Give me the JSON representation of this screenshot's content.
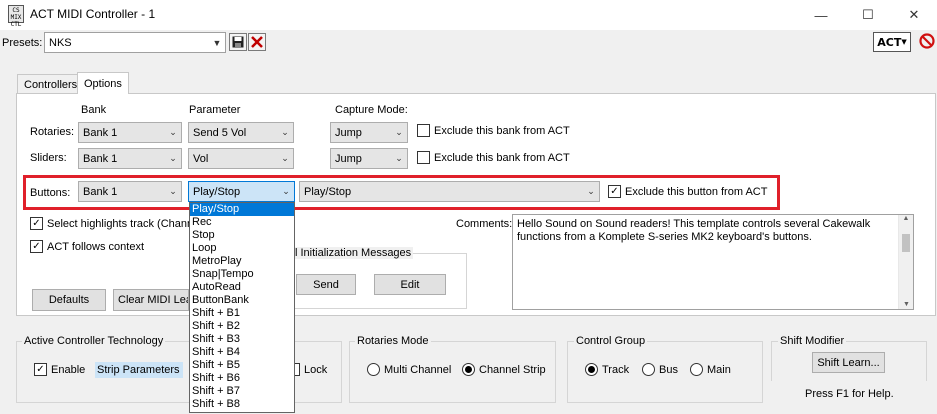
{
  "window": {
    "title": "ACT MIDI Controller - 1",
    "icon_text": "CS\nMIX\nCTL",
    "minimize": "—",
    "maximize": "☐",
    "close": "✕"
  },
  "presets": {
    "label": "Presets:",
    "value": "NKS",
    "act_logo": "ACT"
  },
  "tabs": [
    {
      "label": "Controllers"
    },
    {
      "label": "Options"
    }
  ],
  "columns": {
    "bank": "Bank",
    "parameter": "Parameter",
    "capture_mode": "Capture Mode:"
  },
  "rotaries": {
    "label": "Rotaries:",
    "bank": "Bank 1",
    "parameter": "Send 5 Vol",
    "capture": "Jump",
    "exclude_label": "Exclude this bank from ACT",
    "exclude_checked": false
  },
  "sliders": {
    "label": "Sliders:",
    "bank": "Bank 1",
    "parameter": "Vol",
    "capture": "Jump",
    "exclude_label": "Exclude this bank from ACT",
    "exclude_checked": false
  },
  "buttons": {
    "label": "Buttons:",
    "bank": "Bank 1",
    "parameter": "Play/Stop",
    "action": "Play/Stop",
    "exclude_label": "Exclude this button from ACT",
    "exclude_checked": true
  },
  "options": {
    "select_highlights": {
      "label": "Select highlights track (Channe",
      "checked": true
    },
    "act_follows": {
      "label": "ACT follows context",
      "checked": true
    },
    "defaults_button": "Defaults",
    "clear_midi_button": "Clear MIDI Lea"
  },
  "init_messages": {
    "title": "l Initialization Messages",
    "send": "Send",
    "edit": "Edit"
  },
  "comments": {
    "label": "Comments:",
    "text": "Hello Sound on Sound readers! This template controls several Cakewalk functions from a Komplete S-series MK2 keyboard's buttons."
  },
  "dropdown": {
    "items": [
      "Play/Stop",
      "Rec",
      "Stop",
      "Loop",
      "MetroPlay",
      "Snap|Tempo",
      "AutoRead",
      "ButtonBank",
      "Shift + B1",
      "Shift + B2",
      "Shift + B3",
      "Shift + B4",
      "Shift + B5",
      "Shift + B6",
      "Shift + B7",
      "Shift + B8"
    ],
    "selected_index": 0
  },
  "act_group": {
    "title": "Active Controller Technology",
    "enable_label": "Enable",
    "enable_checked": true,
    "mode_value": "Strip Parameters",
    "lock_label": "Lock"
  },
  "rotaries_mode": {
    "title": "Rotaries Mode",
    "multi_channel": "Multi Channel",
    "channel_strip": "Channel Strip",
    "selected": "Channel Strip"
  },
  "control_group": {
    "title": "Control Group",
    "track": "Track",
    "bus": "Bus",
    "main": "Main",
    "selected": "Track"
  },
  "shift_modifier": {
    "title": "Shift Modifier",
    "button": "Shift Learn..."
  },
  "help_text": "Press F1 for Help."
}
